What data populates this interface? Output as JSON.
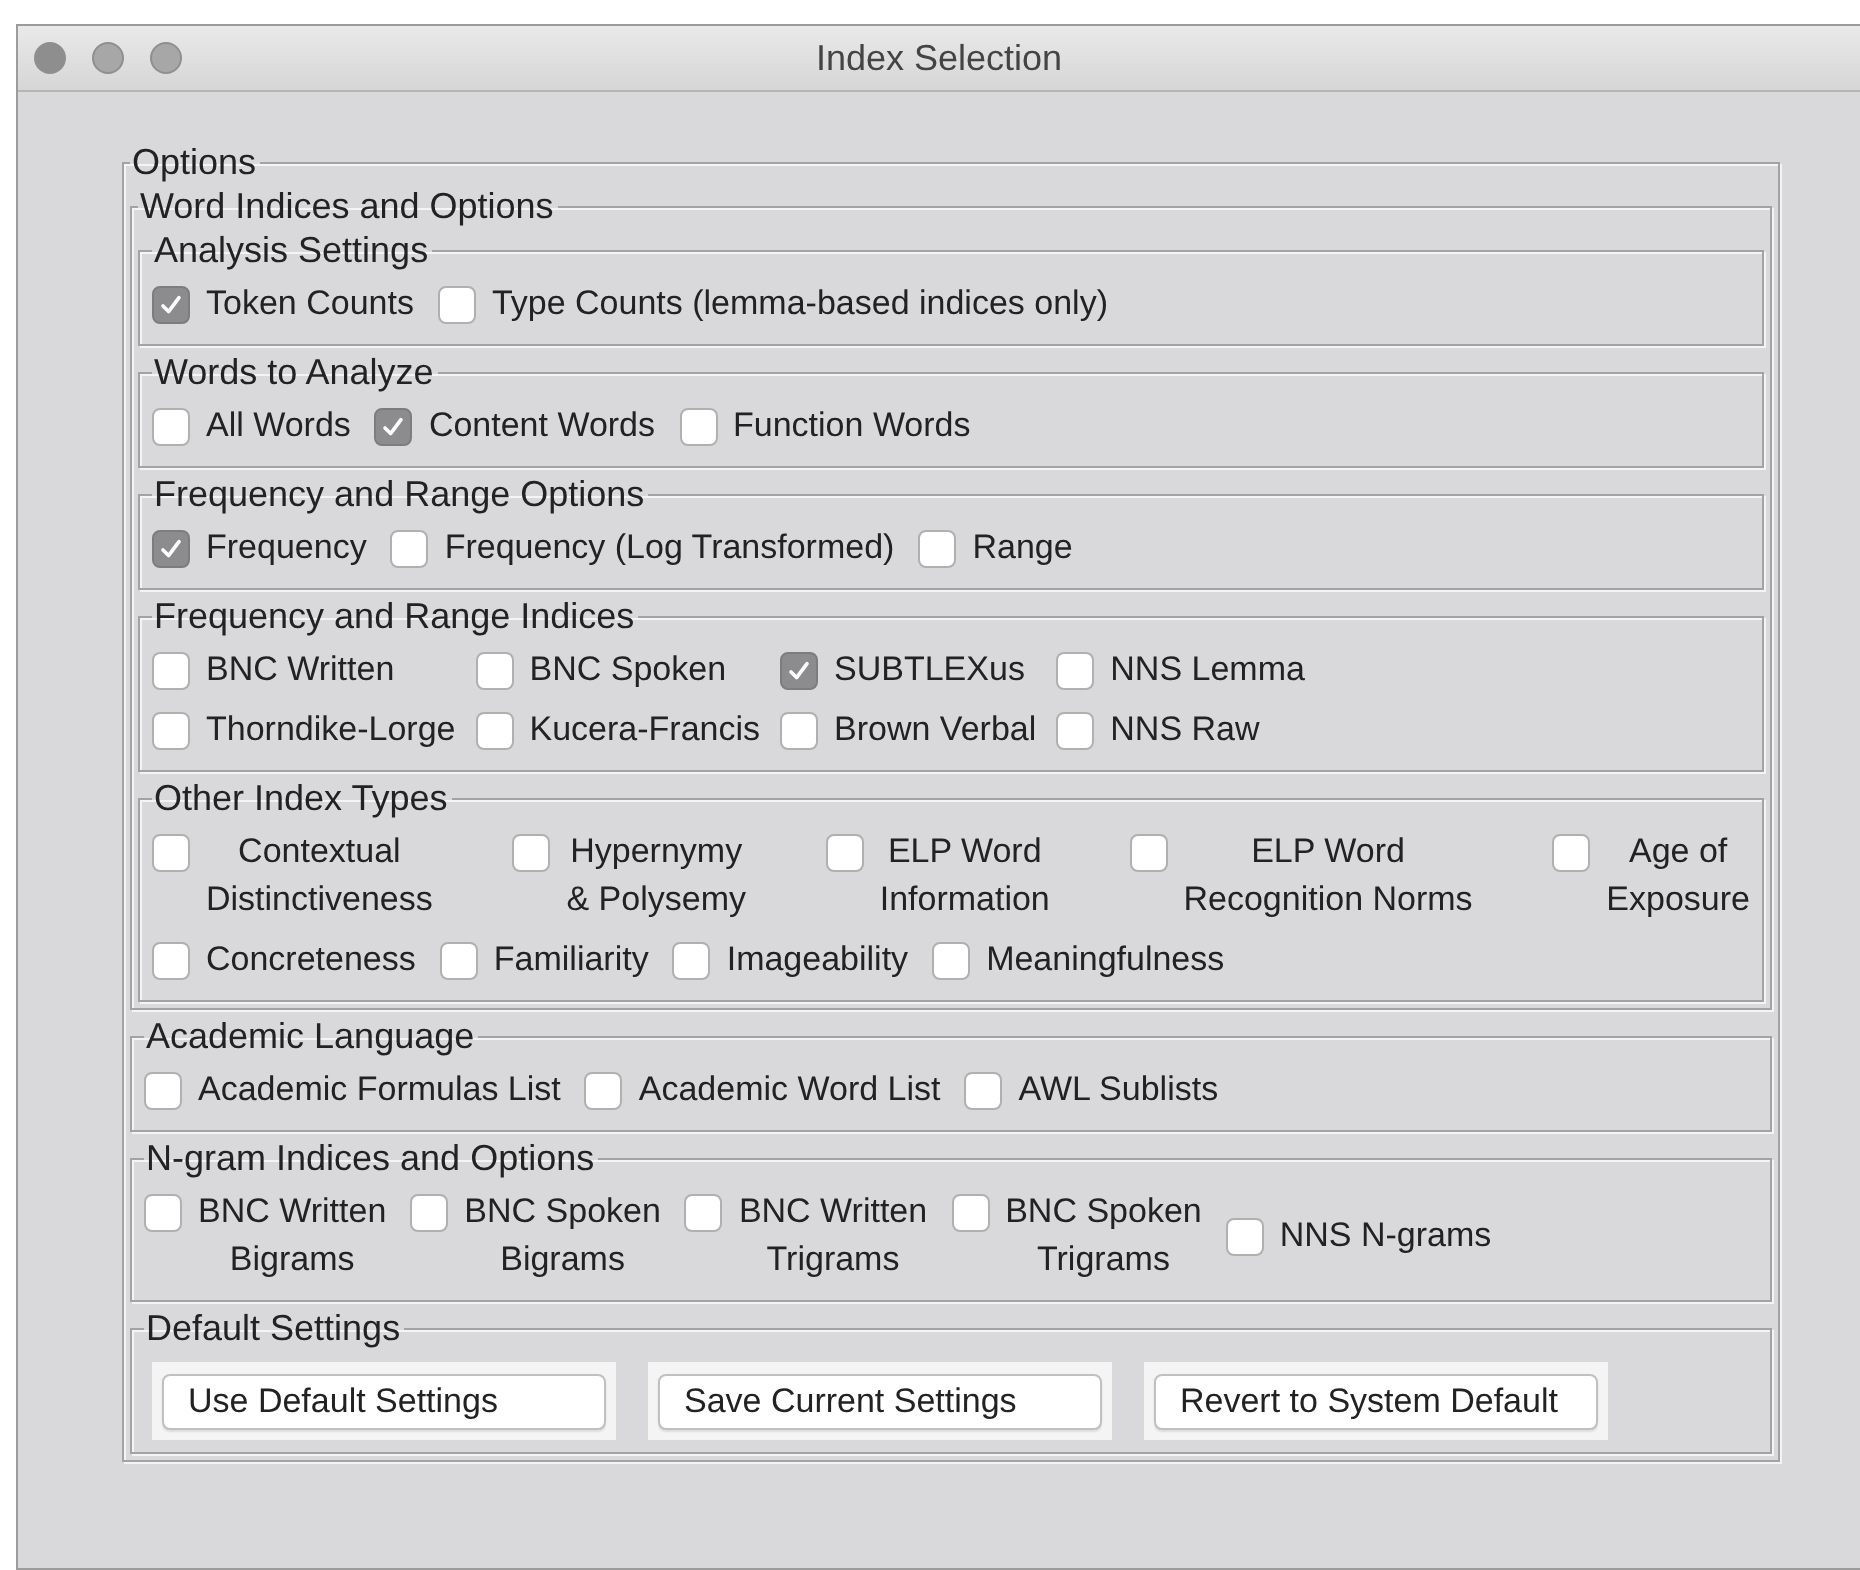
{
  "window": {
    "title": "Index Selection"
  },
  "options": {
    "legend": "Options",
    "sections": [
      {
        "kind": "container",
        "legend": "Word Indices and Options",
        "groups": [
          {
            "legend": "Analysis Settings",
            "kind": "rows",
            "rows": [
              {
                "kind": "flow",
                "items": [
                  {
                    "label": "Token Counts",
                    "checked": true
                  },
                  {
                    "label": "Type Counts (lemma-based indices only)",
                    "checked": false
                  }
                ]
              }
            ]
          },
          {
            "legend": "Words to Analyze",
            "kind": "rows",
            "rows": [
              {
                "kind": "flow",
                "items": [
                  {
                    "label": "All Words",
                    "checked": false
                  },
                  {
                    "label": "Content Words",
                    "checked": true
                  },
                  {
                    "label": "Function Words",
                    "checked": false
                  }
                ]
              }
            ]
          },
          {
            "legend": "Frequency and Range Options",
            "kind": "rows",
            "rows": [
              {
                "kind": "flow",
                "items": [
                  {
                    "label": "Frequency",
                    "checked": true
                  },
                  {
                    "label": "Frequency (Log Transformed)",
                    "checked": false
                  },
                  {
                    "label": "Range",
                    "checked": false
                  }
                ]
              }
            ]
          },
          {
            "legend": "Frequency and Range Indices",
            "kind": "grid",
            "rows": [
              {
                "kind": "flow",
                "items": [
                  {
                    "label": "BNC Written",
                    "checked": false
                  },
                  {
                    "label": "BNC Spoken",
                    "checked": false
                  },
                  {
                    "label": "SUBTLEXus",
                    "checked": true
                  },
                  {
                    "label": "NNS Lemma",
                    "checked": false
                  }
                ]
              },
              {
                "kind": "flow",
                "items": [
                  {
                    "label": "Thorndike-Lorge",
                    "checked": false
                  },
                  {
                    "label": "Kucera-Francis",
                    "checked": false
                  },
                  {
                    "label": "Brown Verbal",
                    "checked": false
                  },
                  {
                    "label": "NNS Raw",
                    "checked": false
                  }
                ]
              }
            ]
          },
          {
            "legend": "Other Index Types",
            "kind": "rows",
            "rows": [
              {
                "kind": "spread",
                "items": [
                  {
                    "label": "Contextual\nDistinctiveness",
                    "checked": false
                  },
                  {
                    "label": "Hypernymy\n& Polysemy",
                    "checked": false
                  },
                  {
                    "label": "ELP Word\nInformation",
                    "checked": false
                  },
                  {
                    "label": "ELP Word\nRecognition Norms",
                    "checked": false
                  },
                  {
                    "label": "Age of\nExposure",
                    "checked": false
                  }
                ]
              },
              {
                "kind": "flow",
                "items": [
                  {
                    "label": "Concreteness",
                    "checked": false
                  },
                  {
                    "label": "Familiarity",
                    "checked": false
                  },
                  {
                    "label": "Imageability",
                    "checked": false
                  },
                  {
                    "label": "Meaningfulness",
                    "checked": false
                  }
                ]
              }
            ]
          }
        ]
      },
      {
        "kind": "checks",
        "legend": "Academic Language",
        "rows": [
          {
            "kind": "flow",
            "items": [
              {
                "label": "Academic Formulas List",
                "checked": false
              },
              {
                "label": "Academic Word List",
                "checked": false
              },
              {
                "label": "AWL Sublists",
                "checked": false
              }
            ]
          }
        ]
      },
      {
        "kind": "checks",
        "legend": "N-gram Indices and Options",
        "rows": [
          {
            "kind": "flow",
            "items": [
              {
                "label": "BNC Written\nBigrams",
                "checked": false
              },
              {
                "label": "BNC Spoken\nBigrams",
                "checked": false
              },
              {
                "label": "BNC Written\nTrigrams",
                "checked": false
              },
              {
                "label": "BNC Spoken\nTrigrams",
                "checked": false
              },
              {
                "label": "NNS N-grams",
                "checked": false
              }
            ]
          }
        ]
      },
      {
        "kind": "buttons",
        "legend": "Default Settings",
        "buttons": [
          "Use Default Settings",
          "Save Current Settings",
          "Revert to System Default"
        ]
      }
    ]
  }
}
